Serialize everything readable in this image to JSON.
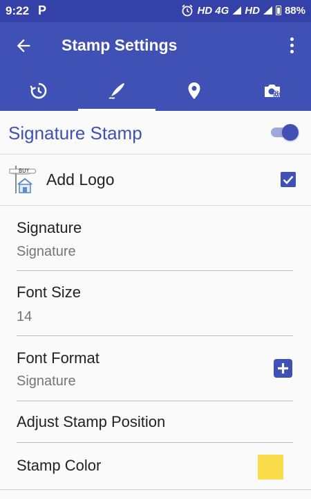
{
  "status_bar": {
    "time": "9:22",
    "notification_icon": "P",
    "network1": "HD 4G",
    "network2": "HD",
    "battery": "88%"
  },
  "app_bar": {
    "title": "Stamp Settings",
    "back_icon": "arrow-back-icon",
    "menu_icon": "more-vert-icon"
  },
  "tabs": [
    {
      "icon": "clock-icon",
      "active": false
    },
    {
      "icon": "signature-pen-icon",
      "active": true
    },
    {
      "icon": "location-pin-icon",
      "active": false
    },
    {
      "icon": "camera-settings-icon",
      "active": false
    }
  ],
  "signature_stamp": {
    "label": "Signature Stamp",
    "enabled": true
  },
  "add_logo": {
    "label": "Add Logo",
    "logo_text": "BUY",
    "checked": true
  },
  "preferences": [
    {
      "title": "Signature",
      "summary": "Signature"
    },
    {
      "title": "Font Size",
      "summary": "14"
    },
    {
      "title": "Font Format",
      "summary": "Signature"
    },
    {
      "title": "Adjust Stamp Position"
    },
    {
      "title": "Stamp Color"
    }
  ],
  "colors": {
    "primary": "#3f51b5",
    "status_bar": "#3341a8",
    "stamp_color": "#fbdd4c"
  }
}
